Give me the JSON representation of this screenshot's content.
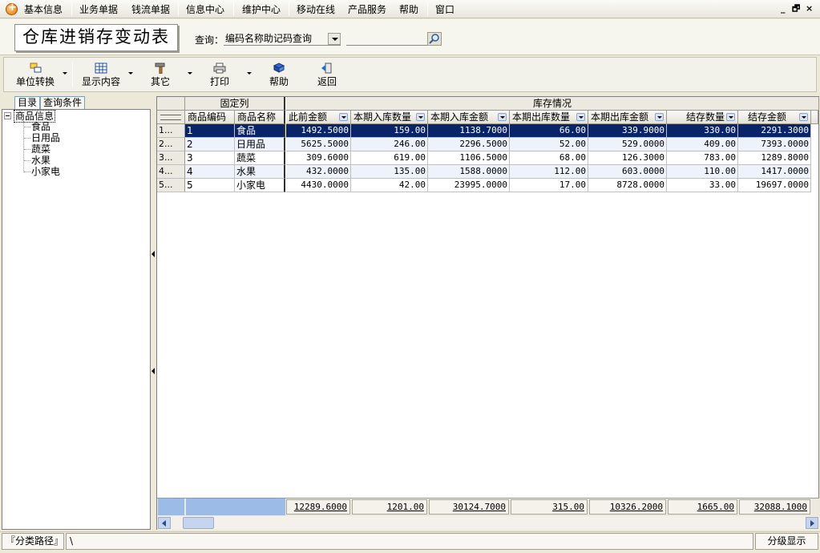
{
  "menu": {
    "items": [
      "基本信息",
      "业务单据",
      "钱流单据",
      "信息中心",
      "维护中心",
      "移动在线",
      "产品服务",
      "帮助",
      "窗口"
    ],
    "window_controls": [
      "_",
      "🗗",
      "×"
    ]
  },
  "title": "仓库进销存变动表",
  "query": {
    "label": "查询：",
    "selected": "编码名称助记码查询",
    "value": ""
  },
  "toolbar": {
    "unit_convert": "单位转换",
    "display_content": "显示内容",
    "other": "其它",
    "print": "打印",
    "help": "帮助",
    "back": "返回"
  },
  "left_tabs": [
    "目录",
    "查询条件"
  ],
  "tree": {
    "root": "商品信息",
    "children": [
      "食品",
      "日用品",
      "蔬菜",
      "水果",
      "小家电"
    ]
  },
  "grid": {
    "bands": {
      "fixed": "固定列",
      "stock": "库存情况"
    },
    "columns": [
      "商品编码",
      "商品名称",
      "此前金额",
      "本期入库数量",
      "本期入库金额",
      "本期出库数量",
      "本期出库金额",
      "结存数量",
      "结存金额"
    ],
    "rows": [
      {
        "idx": "1...",
        "code": "1",
        "name": "食品",
        "prev_amount": "1492.5000",
        "in_qty": "159.00",
        "in_amount": "1138.7000",
        "out_qty": "66.00",
        "out_amount": "339.9000",
        "bal_qty": "330.00",
        "bal_amount": "2291.3000"
      },
      {
        "idx": "2...",
        "code": "2",
        "name": "日用品",
        "prev_amount": "5625.5000",
        "in_qty": "246.00",
        "in_amount": "2296.5000",
        "out_qty": "52.00",
        "out_amount": "529.0000",
        "bal_qty": "409.00",
        "bal_amount": "7393.0000"
      },
      {
        "idx": "3...",
        "code": "3",
        "name": "蔬菜",
        "prev_amount": "309.6000",
        "in_qty": "619.00",
        "in_amount": "1106.5000",
        "out_qty": "68.00",
        "out_amount": "126.3000",
        "bal_qty": "783.00",
        "bal_amount": "1289.8000"
      },
      {
        "idx": "4...",
        "code": "4",
        "name": "水果",
        "prev_amount": "432.0000",
        "in_qty": "135.00",
        "in_amount": "1588.0000",
        "out_qty": "112.00",
        "out_amount": "603.0000",
        "bal_qty": "110.00",
        "bal_amount": "1417.0000"
      },
      {
        "idx": "5...",
        "code": "5",
        "name": "小家电",
        "prev_amount": "4430.0000",
        "in_qty": "42.00",
        "in_amount": "23995.0000",
        "out_qty": "17.00",
        "out_amount": "8728.0000",
        "bal_qty": "33.00",
        "bal_amount": "19697.0000"
      }
    ],
    "totals": {
      "prev_amount": "12289.6000",
      "in_qty": "1201.00",
      "in_amount": "30124.7000",
      "out_qty": "315.00",
      "out_amount": "10326.2000",
      "bal_qty": "1665.00",
      "bal_amount": "32088.1000"
    }
  },
  "status": {
    "path_label": "『分类路径』",
    "path_value": "\\",
    "level_button": "分级显示"
  },
  "colors": {
    "selected_row": "#0a246a",
    "alt_row": "#eef2fb",
    "footer_accent": "#9cbbe6"
  }
}
